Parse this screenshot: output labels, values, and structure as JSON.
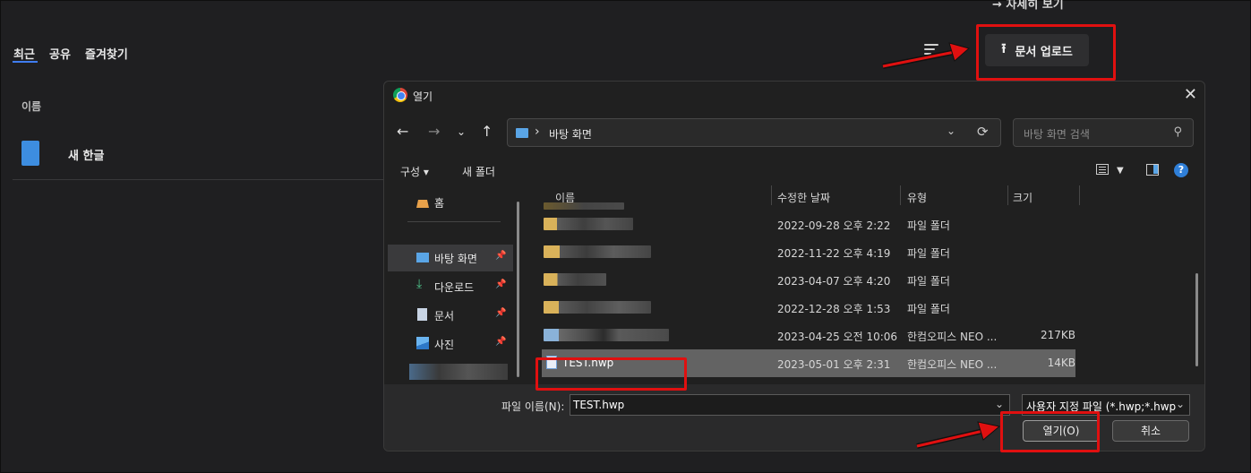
{
  "app": {
    "more_link": "→ 자세히 보기",
    "tabs": [
      {
        "label": "최근"
      },
      {
        "label": "공유"
      },
      {
        "label": "즐겨찾기"
      }
    ],
    "upload_label": "문서 업로드",
    "column_name": "이름",
    "document": {
      "name": "새 한글"
    }
  },
  "dialog": {
    "title": "열기",
    "path_sep": "›",
    "path": "바탕 화면",
    "search_placeholder": "바탕 화면 검색",
    "toolbar": {
      "organize": "구성 ▾",
      "new_folder": "새 폴더"
    },
    "sidebar": [
      {
        "label": "홈",
        "icon": "home-icon"
      },
      {
        "label": "바탕 화면",
        "icon": "desktop-icon",
        "pinned": true
      },
      {
        "label": "다운로드",
        "icon": "download-icon",
        "pinned": true
      },
      {
        "label": "문서",
        "icon": "document-icon",
        "pinned": true
      },
      {
        "label": "사진",
        "icon": "picture-icon",
        "pinned": true
      }
    ],
    "columns": {
      "name": "이름",
      "date": "수정한 날짜",
      "type": "유형",
      "size": "크기"
    },
    "files": [
      {
        "date": "2022-09-28 오후 2:22",
        "type": "파일 폴더",
        "size": ""
      },
      {
        "date": "2022-11-22 오후 4:19",
        "type": "파일 폴더",
        "size": ""
      },
      {
        "date": "2023-04-07 오후 4:20",
        "type": "파일 폴더",
        "size": ""
      },
      {
        "date": "2022-12-28 오후 1:53",
        "type": "파일 폴더",
        "size": ""
      },
      {
        "date": "2023-04-25 오전 10:06",
        "type": "한컴오피스 NEO ...",
        "size": "217KB"
      },
      {
        "name": "TEST.hwp",
        "date": "2023-05-01 오후 2:31",
        "type": "한컴오피스 NEO ...",
        "size": "14KB"
      }
    ],
    "filename_label": "파일 이름(N):",
    "filename_value": "TEST.hwp",
    "filetype_value": "사용자 지정 파일 (*.hwp;*.hwp",
    "open_label": "열기(O)",
    "cancel_label": "취소"
  },
  "colors": {
    "highlight": "#e01010",
    "accent": "#3f7cf0"
  }
}
